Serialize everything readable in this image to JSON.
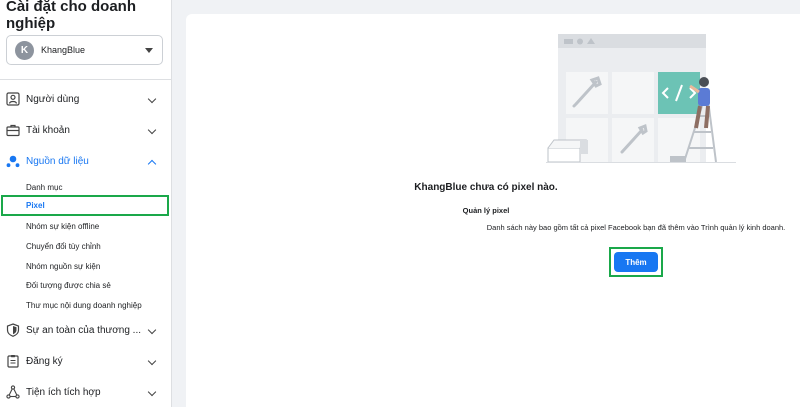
{
  "sidebar": {
    "title": "Cài đặt cho doanh nghiệp",
    "account": {
      "initial": "K",
      "name": "KhangBlue"
    },
    "nav": [
      {
        "label": "Người dùng",
        "icon": "users-icon"
      },
      {
        "label": "Tài khoản",
        "icon": "briefcase-icon"
      },
      {
        "label": "Nguồn dữ liệu",
        "icon": "data-sources-icon",
        "expanded": true
      },
      {
        "label": "Sự an toàn của thương ...",
        "icon": "shield-icon"
      },
      {
        "label": "Đăng ký",
        "icon": "clipboard-icon"
      },
      {
        "label": "Tiện ích tích hợp",
        "icon": "integrations-icon"
      }
    ],
    "data_sources_items": [
      "Danh mục",
      "Pixel",
      "Nhóm sự kiện offline",
      "Chuyển đổi tùy chỉnh",
      "Nhóm nguồn sự kiện",
      "Đối tượng được chia sẻ",
      "Thư mục nội dung doanh nghiệp"
    ],
    "selected_item": "Pixel"
  },
  "main": {
    "empty_title": "KhangBlue chưa có pixel nào.",
    "section_title": "Quản lý pixel",
    "description": "Danh sách này bao gồm tất cả pixel Facebook bạn đã thêm vào Trình quản lý kinh doanh.",
    "add_button": "Thêm"
  },
  "colors": {
    "accent": "#1877f2",
    "highlight_frame": "#1aa84a",
    "illustration_teal": "#6cc3b5"
  }
}
